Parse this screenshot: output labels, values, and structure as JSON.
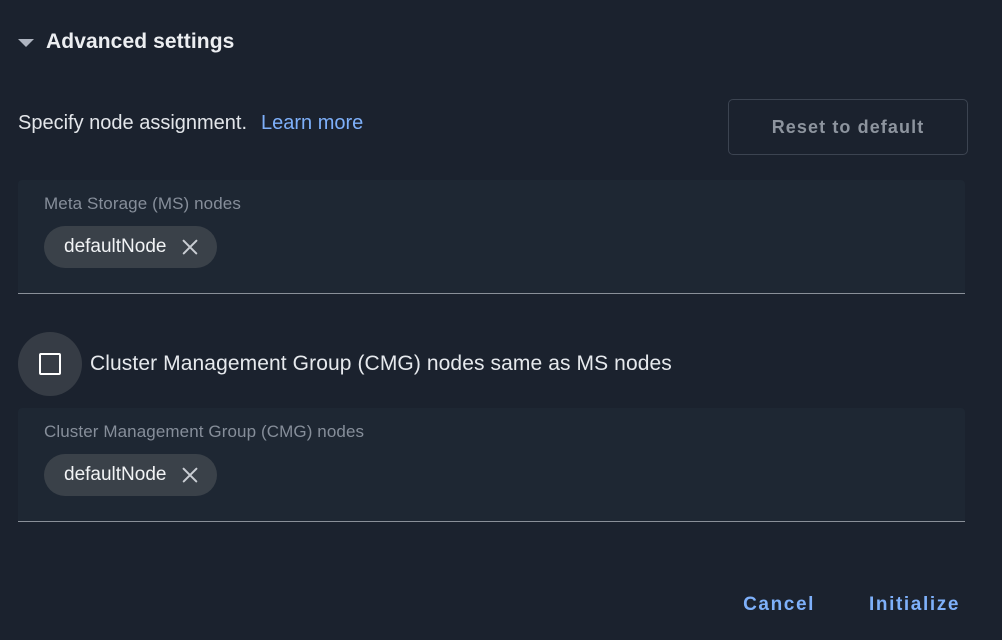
{
  "colors": {
    "page_background": "#1b222e",
    "field_background": "#1e2733",
    "chip_background": "#3a4149",
    "accent_link": "#7eb0fa",
    "muted_text": "#868e9a",
    "divider": "#8a9099"
  },
  "section": {
    "title": "Advanced settings",
    "caret_icon": "chevron-down-icon",
    "expanded": true
  },
  "description": {
    "text": "Specify node assignment.",
    "link_label": "Learn more"
  },
  "reset_button": {
    "label": "Reset to default"
  },
  "fields": [
    {
      "label": "Meta Storage (MS) nodes",
      "chips": [
        {
          "label": "defaultNode",
          "remove_icon": "close-icon"
        }
      ]
    },
    {
      "label": "Cluster Management Group (CMG) nodes",
      "chips": [
        {
          "label": "defaultNode",
          "remove_icon": "close-icon"
        }
      ]
    }
  ],
  "checkbox": {
    "label": "Cluster Management Group (CMG) nodes same as MS nodes",
    "checked": false
  },
  "footer": {
    "cancel_label": "Cancel",
    "primary_label": "Initialize"
  }
}
